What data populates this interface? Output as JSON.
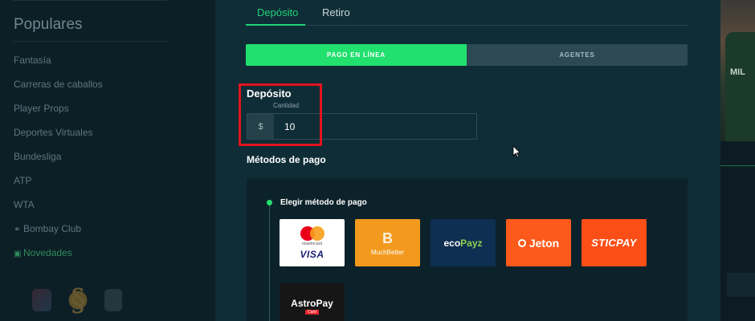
{
  "sidebar": {
    "title": "Populares",
    "items": [
      {
        "label": "Fantasía"
      },
      {
        "label": "Carreras de caballos"
      },
      {
        "label": "Player Props"
      },
      {
        "label": "Deportes Virtuales"
      },
      {
        "label": "Bundesliga"
      },
      {
        "label": "ATP"
      },
      {
        "label": "WTA"
      },
      {
        "label": "Bombay Club",
        "icon": "lamp-icon"
      },
      {
        "label": "Novedades",
        "icon": "chat-icon"
      }
    ],
    "bottom_icons": [
      "sports-card-icon",
      "bombay-logo-icon",
      "cards-icon"
    ]
  },
  "tabs": [
    {
      "label": "Depósito",
      "active": true
    },
    {
      "label": "Retiro",
      "active": false
    }
  ],
  "segments": [
    {
      "label": "PAGO EN LÍNEA",
      "active": true
    },
    {
      "label": "AGENTES",
      "active": false
    }
  ],
  "deposit": {
    "title": "Depósito",
    "amount_label": "Cantidad",
    "currency_symbol": "$",
    "amount_value": "10"
  },
  "payment_methods": {
    "title": "Métodos de pago",
    "choose_label": "Elegir método de pago",
    "options": [
      {
        "name": "Mastercard Visa",
        "brand_top": "mastercard",
        "brand_bottom": "VISA"
      },
      {
        "name": "MuchBetter",
        "logo": "B",
        "text": "MuchBetter"
      },
      {
        "name": "ecoPayz",
        "text_a": "eco",
        "text_b": "Payz"
      },
      {
        "name": "Jeton",
        "text": "Jeton"
      },
      {
        "name": "STICPAY",
        "text": "STICPAY"
      },
      {
        "name": "AstroPay",
        "text": "AstroPay",
        "sub": "Card"
      }
    ]
  },
  "background": {
    "player_jersey_text": "MIL"
  },
  "colors": {
    "accent_green": "#21d37a",
    "highlight_red": "#e0141e",
    "modal_bg": "#0f2d36"
  }
}
